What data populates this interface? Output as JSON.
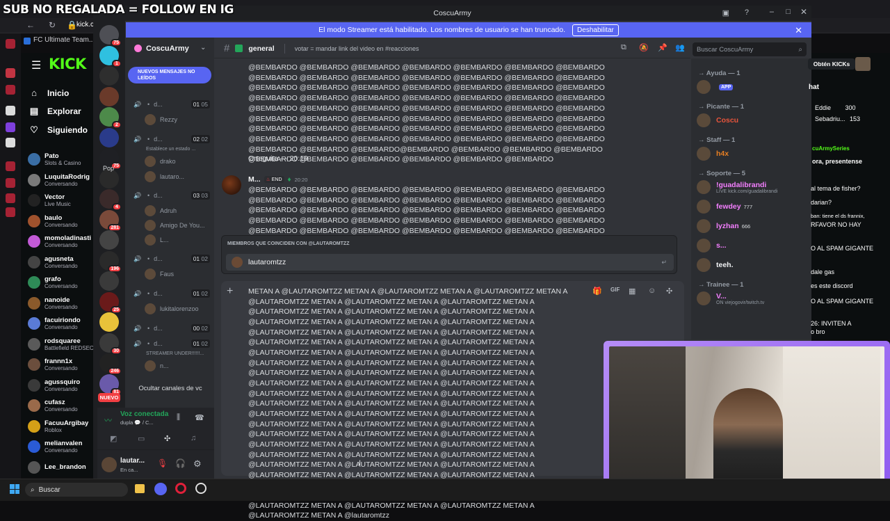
{
  "overlay": {
    "text": "SUB NO REGALADA = FOLLOW EN IG"
  },
  "browser": {
    "tab1": "kick.c",
    "bookmark": "FC Ultimate Team..."
  },
  "kick": {
    "logo": "KICK",
    "nav": [
      {
        "label": "Inicio",
        "icon": "home-icon"
      },
      {
        "label": "Explorar",
        "icon": "compass-icon"
      },
      {
        "label": "Siguiendo",
        "icon": "heart-icon"
      }
    ],
    "channels": [
      {
        "name": "Pato",
        "status": "Slots & Casino",
        "color": "#3a6ea5"
      },
      {
        "name": "LuquitaRodrig",
        "status": "Conversando",
        "color": "#7a7a7a"
      },
      {
        "name": "Vector",
        "status": "Live Music",
        "color": "#222"
      },
      {
        "name": "baulo",
        "status": "Conversando",
        "color": "#a0522d"
      },
      {
        "name": "momoladinasti",
        "status": "Conversando",
        "color": "#c25ad6"
      },
      {
        "name": "agusneta",
        "status": "Conversando",
        "color": "#444"
      },
      {
        "name": "grafo",
        "status": "Conversando",
        "color": "#2e8b57"
      },
      {
        "name": "nanoide",
        "status": "Conversando",
        "color": "#8b5a2b"
      },
      {
        "name": "facuiriondo",
        "status": "Conversando",
        "color": "#5a7bd6"
      },
      {
        "name": "rodsquaree",
        "status": "Battlefield REDSEC",
        "color": "#5a5a5a"
      },
      {
        "name": "frannn1x",
        "status": "Conversando",
        "color": "#6b4e3d"
      },
      {
        "name": "agussquiro",
        "status": "Conversando",
        "color": "#3a3a3a"
      },
      {
        "name": "cufasz",
        "status": "Conversando",
        "color": "#9a6a4a"
      },
      {
        "name": "FacuuArgibay",
        "status": "Roblox",
        "color": "#d4a017"
      },
      {
        "name": "melianvalen",
        "status": "Conversando",
        "color": "#2a5bd6"
      },
      {
        "name": "Lee_brandon",
        "status": "",
        "color": "#555"
      }
    ],
    "chat_right": {
      "get_kicks": "Obtén KICKs",
      "chat_label": "hat",
      "top_users": [
        {
          "name": "Eddie",
          "count": "300"
        },
        {
          "name": "Sebadriu...",
          "count": "153"
        }
      ],
      "pinned": "cuArmySeries",
      "pinned2": "ora, presentense",
      "lines": [
        "al tema de fisher?",
        "darian?",
        "ban: tiene el ds frannix,",
        "RFAVOR NO HAY",
        "O AL SPAM GIGANTE",
        "dale gas",
        "es este discord",
        "O AL SPAM GIGANTE",
        "26: INVITEN A",
        "o bro"
      ]
    }
  },
  "discord": {
    "window_title": "CoscuArmy",
    "streamer_banner": "El modo Streamer está habilitado. Los nombres de usuario se han truncado.",
    "banner_button": "Deshabilitar",
    "server_badges": [
      "75",
      "1",
      "",
      "",
      "2",
      "",
      "75",
      "",
      "4",
      "281",
      "",
      "196",
      "",
      "25",
      "",
      "30",
      "246",
      "81"
    ],
    "server_name": "CoscuArmy",
    "new_messages": "NUEVOS MENSAJES NO LEÍDOS",
    "voice_channels": [
      {
        "label": "d...",
        "a": "01",
        "b": "05"
      },
      {
        "label": "d...",
        "a": "02",
        "b": "02"
      },
      {
        "label": "d...",
        "a": "03",
        "b": "03"
      },
      {
        "label": "d...",
        "a": "01",
        "b": "02"
      },
      {
        "label": "d...",
        "a": "01",
        "b": "02"
      },
      {
        "label": "d...",
        "a": "00",
        "b": "02"
      },
      {
        "label": "d...",
        "a": "01",
        "b": "02"
      }
    ],
    "voice_users": [
      "Rezzy",
      "Establece un estado ...",
      "drako",
      "lautaro...",
      "Adruh",
      "Amigo De You...",
      "L...",
      "Faus",
      "lukitalorenzoo",
      "STREAMER UNDER!!!!!!...",
      "n..."
    ],
    "hide_vc": "Ocultar canales de vc",
    "new_label": "NUEVO",
    "pop_label": "Pop",
    "voice_connected": "Voz conectada",
    "voice_sub": "dupla 💬 / C...",
    "username": "lautar...",
    "user_status": "En ca...",
    "channel": {
      "name": "general",
      "topic": "votar = mandar link del video en #reacciones"
    },
    "search_placeholder": "Buscar CoscuArmy",
    "msg1_text": "@BEMBARDO @BEMBARDO @BEMBARDO @BEMBARDO @BEMBARDO @BEMBARDO @BEMBARDO @BEMBARDO @BEMBARDO @BEMBARDO @BEMBARDO @BEMBARDO @BEMBARDO @BEMBARDO @BEMBARDO @BEMBARDO @BEMBARDO @BEMBARDO @BEMBARDO @BEMBARDO @BEMBARDO @BEMBARDO @BEMBARDO @BEMBARDO @BEMBARDO @BEMBARDO @BEMBARDO @BEMBARDO @BEMBARDO @BEMBARDO @BEMBARDO @BEMBARDO @BEMBARDO @BEMBARDO @BEMBARDO @BEMBARDO @BEMBARDO @BEMBARDO @BEMBARDO @BEMBARDO @BEMBARDO @BEMBARDO @BEMBARDO @BEMBARDO @BEMBARDO @BEMBARDO @BEMBARDO @BEMBARDO @BEMBARDO @BEMBARDO @BEMBARDO @BEMBARDO @BEMBARDO @BEMBARDO @BEMBARDO @BEMBARDO @BEMBARDO @BEMBARDO @BEMBARDO@BEMBARDO @BEMBARDO @BEMBARDO @BEMBARDO @BEMBARDO @BEMBARDO @BEMBARDO @BEMBARDO @BEMBARDO @BEMBARDO",
    "msg1_footer": "Orteguita — 20:19",
    "msg2_author": "M...",
    "msg2_tag": "END",
    "msg2_time": "20:20",
    "msg2_text": "@BEMBARDO @BEMBARDO @BEMBARDO @BEMBARDO @BEMBARDO @BEMBARDO @BEMBARDO @BEMBARDO @BEMBARDO @BEMBARDO @BEMBARDO @BEMBARDO @BEMBARDO @BEMBARDO @BEMBARDO @BEMBARDO @BEMBARDO @BEMBARDO @BEMBARDO @BEMBARDO @BEMBARDO @BEMBARDO @BEMBARDO @BEMBARDO @BEMBARDO @BEMBARDO @BEMBARDO @BEMBARDO @BEMBARDO @BEMBARDO @BEMBARDO @BEMBARDO @BEMBARDO @BEMBARDO @BEMBARDO @BEMBARDO @BEMBARDO @BEMBARDO @BEMBARDO @BEMBARDO @BEMBARDO @BEMBARDO @BEMBARDO @BEMBARDO @BEMBARDO @BEMBARDO @BEMBARDO @BEMBARDO @BEMBARDO @BEMBARDO",
    "mention_header": "MIEMBROS QUE COINCIDEN CON @LAUTAROMTZZ",
    "mention_user": "lautaromtzz",
    "composer_text": "METAN A @LAUTAROMTZZ METAN A @LAUTAROMTZZ METAN A @LAUTAROMTZZ METAN A @LAUTAROMTZZ METAN A @LAUTAROMTZZ METAN A @LAUTAROMTZZ METAN A @LAUTAROMTZZ METAN A @LAUTAROMTZZ METAN A @LAUTAROMTZZ METAN A @LAUTAROMTZZ METAN A @LAUTAROMTZZ METAN A @LAUTAROMTZZ METAN A @LAUTAROMTZZ METAN A @LAUTAROMTZZ METAN A @LAUTAROMTZZ METAN A @LAUTAROMTZZ METAN A @LAUTAROMTZZ METAN A @LAUTAROMTZZ METAN A @LAUTAROMTZZ METAN A @LAUTAROMTZZ METAN A @LAUTAROMTZZ METAN A @LAUTAROMTZZ METAN A @LAUTAROMTZZ METAN A @LAUTAROMTZZ METAN A @LAUTAROMTZZ METAN A @LAUTAROMTZZ METAN A @LAUTAROMTZZ METAN A @LAUTAROMTZZ METAN A @LAUTAROMTZZ METAN A @LAUTAROMTZZ METAN A @LAUTAROMTZZ METAN A @LAUTAROMTZZ METAN A @LAUTAROMTZZ METAN A @LAUTAROMTZZ METAN A @LAUTAROMTZZ METAN A @LAUTAROMTZZ METAN A @LAUTAROMTZZ METAN A @LAUTAROMTZZ METAN A @LAUTAROMTZZ METAN A @LAUTAROMTZZ METAN A @LAUTAROMTZZ METAN A @LAUTAROMTZZ METAN A @LAUTAROMTZZ METAN A @LAUTAROMTZZ METAN A @LAUTAROMTZZ METAN A @LAUTAROMTZZ METAN A @LAUTAROMTZZ METAN A @LAUTAROMTZZ METAN A @LAUTAROMTZZ METAN A @LAUTAROMTZZ METAN A @LAUTAROMTZZ METAN A @LAUTAROMTZZ METAN A @LAUTAROMTZZ METAN A @LAUTAROMTZZ METAN A @LAUTAROMTZZ METAN A @LAUTAROMTZZ METAN A @LAUTAROMTZZ METAN A @LAUTAROMTZZ METAN A @LAUTAROMTZZ METAN A @LAUTAROMTZZ METAN A @LAUTAROMTZZ METAN A @LAUTAROMTZZ METAN A @LAUTAROMTZZ METAN A @LAUTAROMTZZ METAN A @LAUTAROMTZZ METAN A @LAUTAROMTZZ METAN A @LAUTAROMTZZ METAN A @lautaromtzz",
    "members": {
      "roles": [
        {
          "label": "→ Ayuda — 1",
          "users": [
            {
              "name": "",
              "tag": "APP",
              "color": "#949ba4"
            }
          ]
        },
        {
          "label": "→ Picante — 1",
          "users": [
            {
              "name": "Coscu",
              "color": "#e8543b"
            }
          ]
        },
        {
          "label": "→ Staff — 1",
          "users": [
            {
              "name": "h4x",
              "color": "#e67e22"
            }
          ]
        },
        {
          "label": "→ Soporte — 5",
          "users": [
            {
              "name": "!guadalibrandi",
              "sub": "LIVE kick.com/guadalibrandi",
              "color": "#f47fff"
            },
            {
              "name": "fewdey",
              "sub": "",
              "badge": "777",
              "color": "#f47fff"
            },
            {
              "name": "lyzhan",
              "badge": "666",
              "color": "#f47fff"
            },
            {
              "name": "s...",
              "color": "#f47fff"
            },
            {
              "name": "teeh.",
              "color": "#f2f3f5"
            }
          ]
        },
        {
          "label": "→ Trainee — 1",
          "users": [
            {
              "name": "V...",
              "sub": "ON viejogovir/twitch.tv",
              "color": "#f47fff"
            }
          ]
        }
      ]
    }
  },
  "taskbar": {
    "search": "Buscar"
  },
  "colors": {
    "discord_blurple": "#5865f2",
    "kick_green": "#53fc18",
    "mention_pink": "#f47fff"
  }
}
